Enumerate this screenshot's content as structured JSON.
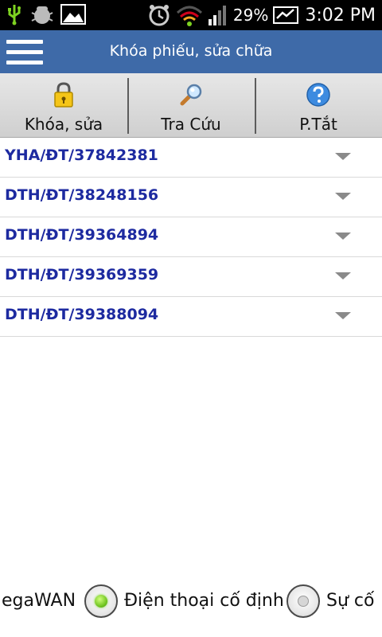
{
  "status_bar": {
    "battery_percent": "29%",
    "time": "3:02 PM",
    "icons": [
      "usb-icon",
      "debug-icon",
      "image-icon",
      "alarm-icon",
      "wifi-icon",
      "signal-icon",
      "battery-icon"
    ]
  },
  "app_bar": {
    "title": "Khóa phiếu, sửa chữa",
    "color": "#3e6aa8"
  },
  "tabs": [
    {
      "label": "Khóa, sửa",
      "icon": "lock-icon"
    },
    {
      "label": "Tra Cứu",
      "icon": "magnifier-icon"
    },
    {
      "label": "P.Tắt",
      "icon": "help-icon"
    }
  ],
  "records": [
    {
      "code": "YHA/ĐT/37842381"
    },
    {
      "code": "DTH/ĐT/38248156"
    },
    {
      "code": "DTH/ĐT/39364894"
    },
    {
      "code": "DTH/ĐT/39369359"
    },
    {
      "code": "DTH/ĐT/39388094"
    }
  ],
  "service_options": {
    "left_partial": "egaWAN",
    "selected": "Điện thoại cố định",
    "right_partial": "Sự cố"
  }
}
